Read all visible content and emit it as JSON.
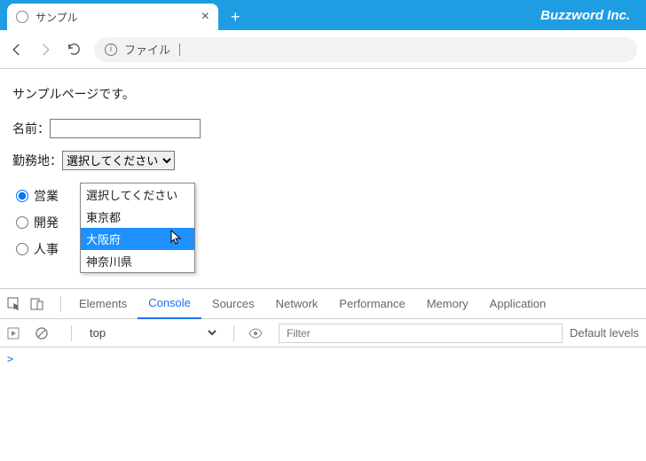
{
  "browser": {
    "tab_title": "サンプル",
    "brand": "Buzzword Inc.",
    "address_label": "ファイル"
  },
  "page": {
    "heading": "サンプルページです。",
    "name_label": "名前：",
    "name_value": "",
    "location_label": "勤務地：",
    "select_placeholder": "選択してください",
    "options": {
      "o0": "選択してください",
      "o1": "東京都",
      "o2": "大阪府",
      "o3": "神奈川県"
    },
    "radios": {
      "r0": "営業",
      "r1": "開発",
      "r2": "人事"
    }
  },
  "devtools": {
    "tabs": {
      "elements": "Elements",
      "console": "Console",
      "sources": "Sources",
      "network": "Network",
      "performance": "Performance",
      "memory": "Memory",
      "application": "Application"
    },
    "scope": "top",
    "filter_placeholder": "Filter",
    "levels": "Default levels",
    "prompt": ">"
  }
}
